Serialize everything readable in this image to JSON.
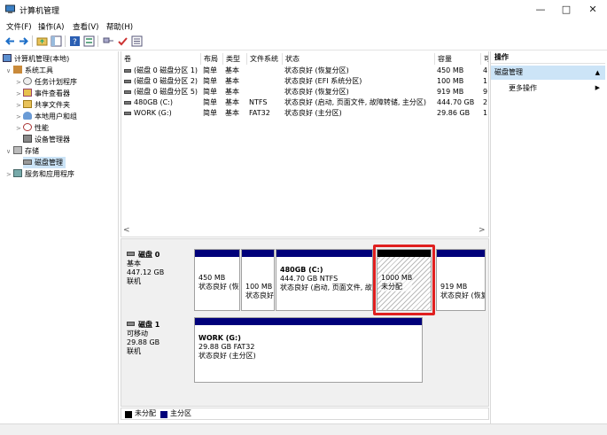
{
  "window": {
    "title": "计算机管理",
    "controls": [
      "minimize-icon",
      "maximize-icon",
      "close-icon"
    ]
  },
  "menu": [
    "文件(F)",
    "操作(A)",
    "查看(V)",
    "帮助(H)"
  ],
  "tree": {
    "root": "计算机管理(本地)",
    "system_tools": "系统工具",
    "task_scheduler": "任务计划程序",
    "event_viewer": "事件查看器",
    "shared_folders": "共享文件夹",
    "local_users": "本地用户和组",
    "performance": "性能",
    "device_manager": "设备管理器",
    "storage": "存储",
    "disk_management": "磁盘管理",
    "services_apps": "服务和应用程序"
  },
  "table": {
    "headers": [
      "卷",
      "布局",
      "类型",
      "文件系统",
      "状态",
      "容量",
      "可"
    ],
    "rows": [
      [
        "(磁盘 0 磁盘分区 1)",
        "简单",
        "基本",
        "",
        "状态良好 (恢复分区)",
        "450 MB",
        "4"
      ],
      [
        "(磁盘 0 磁盘分区 2)",
        "简单",
        "基本",
        "",
        "状态良好 (EFI 系统分区)",
        "100 MB",
        "1"
      ],
      [
        "(磁盘 0 磁盘分区 5)",
        "简单",
        "基本",
        "",
        "状态良好 (恢复分区)",
        "919 MB",
        "9"
      ],
      [
        "480GB (C:)",
        "简单",
        "基本",
        "NTFS",
        "状态良好 (启动, 页面文件, 故障转储, 主分区)",
        "444.70 GB",
        "2"
      ],
      [
        "WORK (G:)",
        "简单",
        "基本",
        "FAT32",
        "状态良好 (主分区)",
        "29.86 GB",
        "1"
      ]
    ]
  },
  "disk0": {
    "name": "磁盘 0",
    "type": "基本",
    "size": "447.12 GB",
    "status": "联机",
    "parts": [
      {
        "l1": "",
        "l2": "450 MB",
        "l3": "状态良好 (恢"
      },
      {
        "l1": "",
        "l2": "100 MB",
        "l3": "状态良好"
      },
      {
        "l1": "480GB (C:)",
        "l2": "444.70 GB NTFS",
        "l3": "状态良好 (启动, 页面文件, 故"
      },
      {
        "l1": "",
        "l2": "1000 MB",
        "l3": "未分配"
      },
      {
        "l1": "",
        "l2": "919 MB",
        "l3": "状态良好 (恢复"
      }
    ]
  },
  "disk1": {
    "name": "磁盘 1",
    "type": "可移动",
    "size": "29.88 GB",
    "status": "联机",
    "part": {
      "l1": "WORK  (G:)",
      "l2": "29.88 GB FAT32",
      "l3": "状态良好 (主分区)"
    }
  },
  "legend": {
    "unallocated": "未分配",
    "primary": "主分区"
  },
  "actions": {
    "header": "操作",
    "section": "磁盘管理",
    "more": "更多操作"
  },
  "colors": {
    "primary_partition": "#00007a",
    "unallocated": "#000000",
    "highlight_box": "#e02020",
    "selection": "#cce4f7"
  }
}
